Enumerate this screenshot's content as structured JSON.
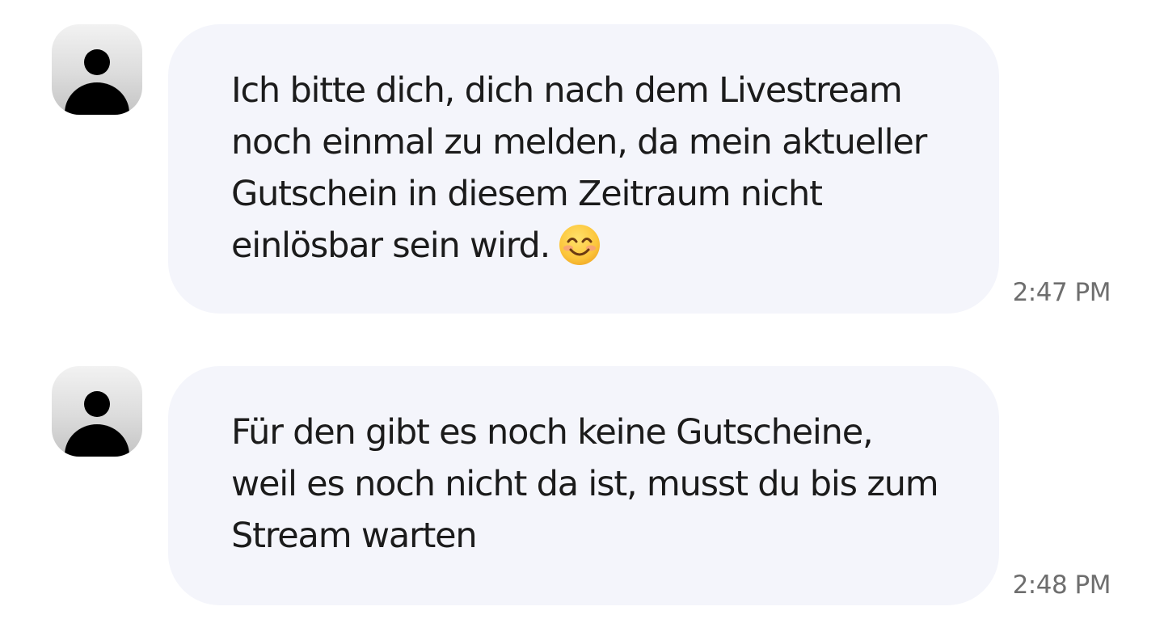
{
  "messages": [
    {
      "text": "Ich bitte dich, dich nach dem Livestream\nnoch einmal zu melden, da mein aktueller\nGutschein in diesem Zeitraum nicht\neinlösbar sein wird.",
      "emoji": "smiling-face-with-smiling-eyes",
      "time": "2:47 PM"
    },
    {
      "text": "Für den gibt es noch keine Gutscheine,\nweil es noch nicht da ist, musst du bis zum\nStream warten",
      "time": "2:48 PM"
    }
  ],
  "colors": {
    "bubble": "#f4f5fb",
    "text": "#1b1b1b",
    "timestamp": "#6e6e6e",
    "avatar_silhouette": "#000000"
  }
}
